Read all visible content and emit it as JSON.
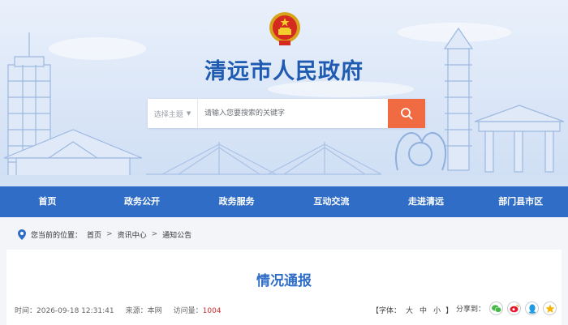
{
  "header": {
    "site_title": "清远市人民政府",
    "emblem": "national-emblem",
    "colors": {
      "title": "#1f5bb0",
      "search_button": "#f06a42"
    }
  },
  "search": {
    "select_label": "选择主题",
    "placeholder": "请输入您要搜索的关键字",
    "button_icon": "search-icon"
  },
  "nav": {
    "color": "#2f6dc6",
    "items": [
      {
        "label": "首页"
      },
      {
        "label": "政务公开"
      },
      {
        "label": "政务服务"
      },
      {
        "label": "互动交流"
      },
      {
        "label": "走进清远"
      },
      {
        "label": "部门县市区"
      }
    ]
  },
  "breadcrumb": {
    "icon": "location-pin-icon",
    "prefix": "您当前的位置：",
    "items": [
      "首页",
      "资讯中心",
      "通知公告"
    ],
    "separator": ">"
  },
  "article": {
    "title": "情况通报",
    "time_label": "时间：",
    "time": "2026-09-18 12:31:41",
    "source_label": "来源：",
    "source": "本网",
    "views_label": "访问量：",
    "views": "1004",
    "fontsize_open": "【字体：",
    "fontsize_large": "大",
    "fontsize_medium": "中",
    "fontsize_small": "小",
    "fontsize_close": "】",
    "share_label": "分享到："
  },
  "share_icons": [
    "wechat-icon",
    "weibo-icon",
    "qq-icon",
    "qzone-icon"
  ]
}
